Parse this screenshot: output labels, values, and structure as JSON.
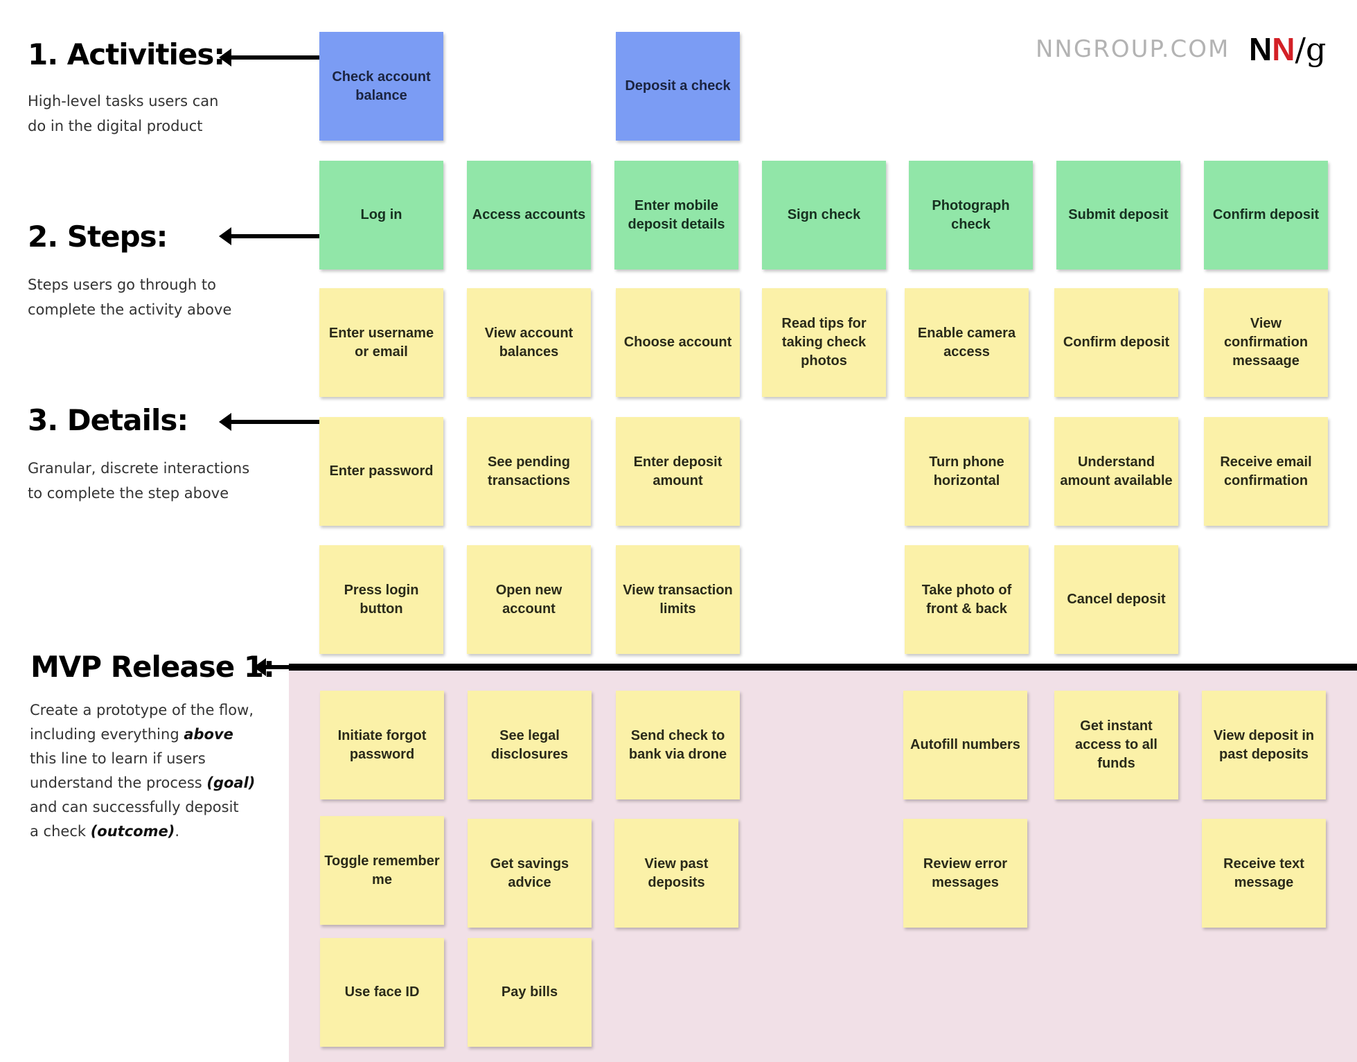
{
  "brand": {
    "site": "NNGROUP.COM",
    "logo_n1": "N",
    "logo_n2": "N",
    "logo_slash_g": "/g",
    "accent_red": "#d32026"
  },
  "colors": {
    "activity": "#7b9cf4",
    "step": "#91e6a8",
    "detail": "#fbf1a8",
    "mvp_zone": "#f1e0e7"
  },
  "sections": {
    "activities": {
      "heading": "1. Activities:",
      "desc": [
        "High-level tasks users can",
        "do in the digital product"
      ]
    },
    "steps": {
      "heading": "2. Steps:",
      "desc": [
        "Steps users go through to",
        "complete the activity above"
      ]
    },
    "details": {
      "heading": "3. Details:",
      "desc": [
        "Granular, discrete interactions",
        "to complete the step above"
      ]
    },
    "mvp": {
      "heading": "MVP Release 1:",
      "desc": {
        "l1": "Create a prototype of the flow,",
        "l2a": "including everything ",
        "l2b": "above",
        "l3": "this line to learn if users",
        "l4a": "understand the process ",
        "l4b": "(goal)",
        "l5": "and can successfully deposit",
        "l6a": "a check ",
        "l6b": "(outcome)",
        "l6c": "."
      }
    }
  },
  "activities": [
    {
      "label": "Check account balance",
      "column": 1
    },
    {
      "label": "Deposit a check",
      "column": 3
    }
  ],
  "steps": [
    "Log in",
    "Access accounts",
    "Enter mobile deposit details",
    "Sign check",
    "Photograph check",
    "Submit deposit",
    "Confirm deposit"
  ],
  "details": {
    "row1": [
      "Enter username or email",
      "View account balances",
      "Choose account",
      "Read tips for taking check photos",
      "Enable camera access",
      "Confirm deposit",
      "View confirmation messaage"
    ],
    "row2": [
      "Enter password",
      "See pending transactions",
      "Enter deposit amount",
      "",
      "Turn phone horizontal",
      "Understand amount available",
      "Receive email confirmation"
    ],
    "row3": [
      "Press login button",
      "Open new account",
      "View transaction limits",
      "",
      "Take photo of front & back",
      "Cancel deposit",
      ""
    ]
  },
  "mvp_details": {
    "row1": [
      "Initiate forgot password",
      "See legal disclosures",
      "Send check to bank via drone",
      "",
      "Autofill numbers",
      "Get instant access to all funds",
      "View deposit in past deposits"
    ],
    "row2": [
      "Toggle remember me",
      "Get savings advice",
      "View past deposits",
      "",
      "Review error messages",
      "",
      "Receive text message"
    ],
    "row3": [
      "Use face ID",
      "Pay bills",
      "",
      "",
      "",
      "",
      ""
    ]
  }
}
